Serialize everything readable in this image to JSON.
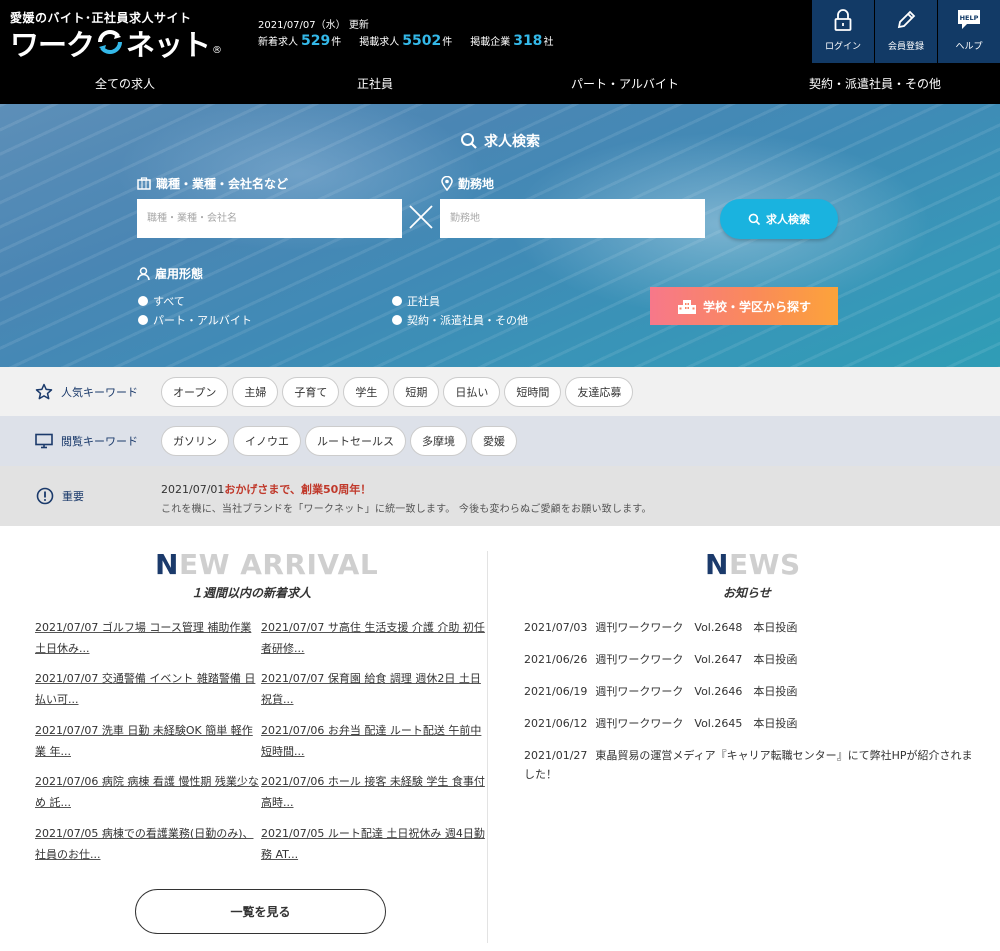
{
  "header": {
    "tagline": "愛媛のバイト･正社員求人サイト",
    "logo": {
      "part1": "ワーク",
      "part2": "ネット",
      "reg": "®"
    },
    "update_date": "2021/07/07（水） 更新",
    "stats": [
      {
        "label": "新着求人",
        "value": "529",
        "unit": "件"
      },
      {
        "label": "掲載求人",
        "value": "5502",
        "unit": "件"
      },
      {
        "label": "掲載企業",
        "value": "318",
        "unit": "社"
      }
    ],
    "buttons": [
      {
        "label": "ログイン",
        "icon": "lock-icon"
      },
      {
        "label": "会員登録",
        "icon": "pencil-icon"
      },
      {
        "label": "ヘルプ",
        "icon": "help-icon",
        "badge": "HELP"
      }
    ],
    "nav": [
      "全ての求人",
      "正社員",
      "パート・アルバイト",
      "契約・派遣社員・その他"
    ]
  },
  "search": {
    "title": "求人検索",
    "job_label": "職種・業種・会社名など",
    "job_placeholder": "職種・業種・会社名",
    "location_label": "勤務地",
    "location_placeholder": "勤務地",
    "button_label": "求人検索",
    "employment_label": "雇用形態",
    "employment_options": [
      "すべて",
      "正社員",
      "パート・アルバイト",
      "契約・派遣社員・その他"
    ],
    "school_button_label": "学校・学区から探す"
  },
  "keywords": {
    "popular_label": "人気キーワード",
    "popular": [
      "オープン",
      "主婦",
      "子育て",
      "学生",
      "短期",
      "日払い",
      "短時間",
      "友達応募"
    ],
    "viewed_label": "閲覧キーワード",
    "viewed": [
      "ガソリン",
      "イノウエ",
      "ルートセールス",
      "多摩境",
      "愛媛"
    ]
  },
  "notice": {
    "label": "重要",
    "date": "2021/07/01",
    "title": "おかげさまで、創業50周年！",
    "body": "これを機に、当社ブランドを「ワークネット」に統一致します。 今後も変わらぬご愛顧をお願い致します。"
  },
  "new_arrival": {
    "title_initial": "N",
    "title_rest": "EW ARRIVAL",
    "subtitle": "１週間以内の新着求人",
    "jobs": [
      "2021/07/07 ゴルフ場 コース管理 補助作業 土日休み...",
      "2021/07/07 サ高住 生活支援 介護 介助 初任者研修...",
      "2021/07/07 交通警備 イベント 雑踏警備 日払い可...",
      "2021/07/07 保育園 給食 調理 週休2日 土日祝貨...",
      "2021/07/07 洗車 日勤 未経験OK 簡単 軽作業 年...",
      "2021/07/06 お弁当 配達 ルート配送 午前中 短時間...",
      "2021/07/06 病院 病棟 看護 慢性期 残業少なめ 託...",
      "2021/07/06 ホール 接客 未経験 学生 食事付 高時...",
      "2021/07/05 病棟での看護業務(日勤のみ)、社員のお仕...",
      "2021/07/05 ルート配達 土日祝休み 週4日勤務 AT..."
    ],
    "more_label": "一覧を見る"
  },
  "news": {
    "title_initial": "N",
    "title_rest": "EWS",
    "subtitle": "お知らせ",
    "items": [
      {
        "date": "2021/07/03",
        "text": "週刊ワークワーク　Vol.2648　本日投函"
      },
      {
        "date": "2021/06/26",
        "text": "週刊ワークワーク　Vol.2647　本日投函"
      },
      {
        "date": "2021/06/19",
        "text": "週刊ワークワーク　Vol.2646　本日投函"
      },
      {
        "date": "2021/06/12",
        "text": "週刊ワークワーク　Vol.2645　本日投函"
      },
      {
        "date": "2021/01/27",
        "text": "東晶貿易の運営メディア『キャリア転職センター』にて弊社HPが紹介されました！"
      }
    ]
  },
  "colors": {
    "header_bg": "#000000",
    "header_button_bg": "#123a66",
    "accent_blue": "#34b8e8",
    "search_button": "#1ab3df",
    "navy": "#1b3a6b",
    "notice_red": "#c0392b"
  }
}
